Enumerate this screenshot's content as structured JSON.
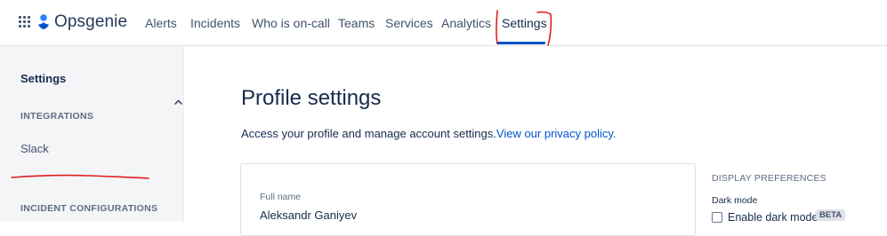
{
  "app": {
    "name": "Opsgenie"
  },
  "nav": {
    "items": [
      {
        "label": "Alerts"
      },
      {
        "label": "Incidents"
      },
      {
        "label": "Who is on-call"
      },
      {
        "label": "Teams"
      },
      {
        "label": "Services"
      },
      {
        "label": "Analytics"
      },
      {
        "label": "Settings",
        "active": true
      }
    ]
  },
  "sidebar": {
    "title": "Settings",
    "sections": [
      {
        "header": "INTEGRATIONS",
        "items": [
          {
            "label": "Slack"
          }
        ]
      },
      {
        "header": "INCIDENT CONFIGURATIONS"
      }
    ]
  },
  "main": {
    "title": "Profile settings",
    "description": "Access your profile and manage account settings.",
    "privacy_link": "View our privacy policy.",
    "profile": {
      "full_name_label": "Full name",
      "full_name_value": "Aleksandr Ganiyev"
    },
    "display_preferences": {
      "header": "DISPLAY PREFERENCES",
      "dark_mode_label": "Dark mode",
      "dark_mode_checkbox_label": "Enable dark mode",
      "badge": "BETA",
      "dark_mode_enabled": false
    }
  },
  "colors": {
    "accent": "#0052cc",
    "annotation": "#e01e1e",
    "sidebar_bg": "#f4f5f7"
  }
}
